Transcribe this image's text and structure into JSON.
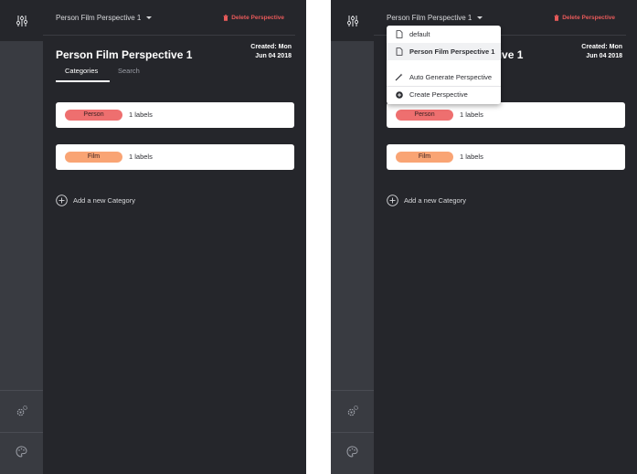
{
  "header": {
    "perspective_selector": "Person Film Perspective 1",
    "delete_label": "Delete Perspective"
  },
  "perspective": {
    "title": "Person Film Perspective 1",
    "created_line1": "Created: Mon",
    "created_line2": "Jun 04 2018"
  },
  "tabs": [
    {
      "label": "Categories",
      "active": true
    },
    {
      "label": "Search",
      "active": false
    }
  ],
  "categories": [
    {
      "name": "Person",
      "count": "1 labels",
      "color": "#ee6f6f"
    },
    {
      "name": "Film",
      "count": "1 labels",
      "color": "#f9a474"
    }
  ],
  "add_category_label": "Add a new Category",
  "dropdown": {
    "items": [
      {
        "label": "default",
        "icon": "document-icon",
        "selected": false
      },
      {
        "label": "Person Film Perspective 1",
        "icon": "document-icon",
        "selected": true
      }
    ],
    "actions": [
      {
        "label": "Auto Generate Perspective",
        "icon": "magic-wand-icon"
      },
      {
        "label": "Create Perspective",
        "icon": "plus-circle-icon"
      }
    ]
  },
  "rail_icons": [
    "sliders-icon",
    "gears-icon",
    "palette-icon"
  ],
  "colors": {
    "background": "#25262b",
    "rail": "#393b41",
    "delete": "#e85a5a",
    "person_chip": "#ee6f6f",
    "film_chip": "#f9a474"
  }
}
